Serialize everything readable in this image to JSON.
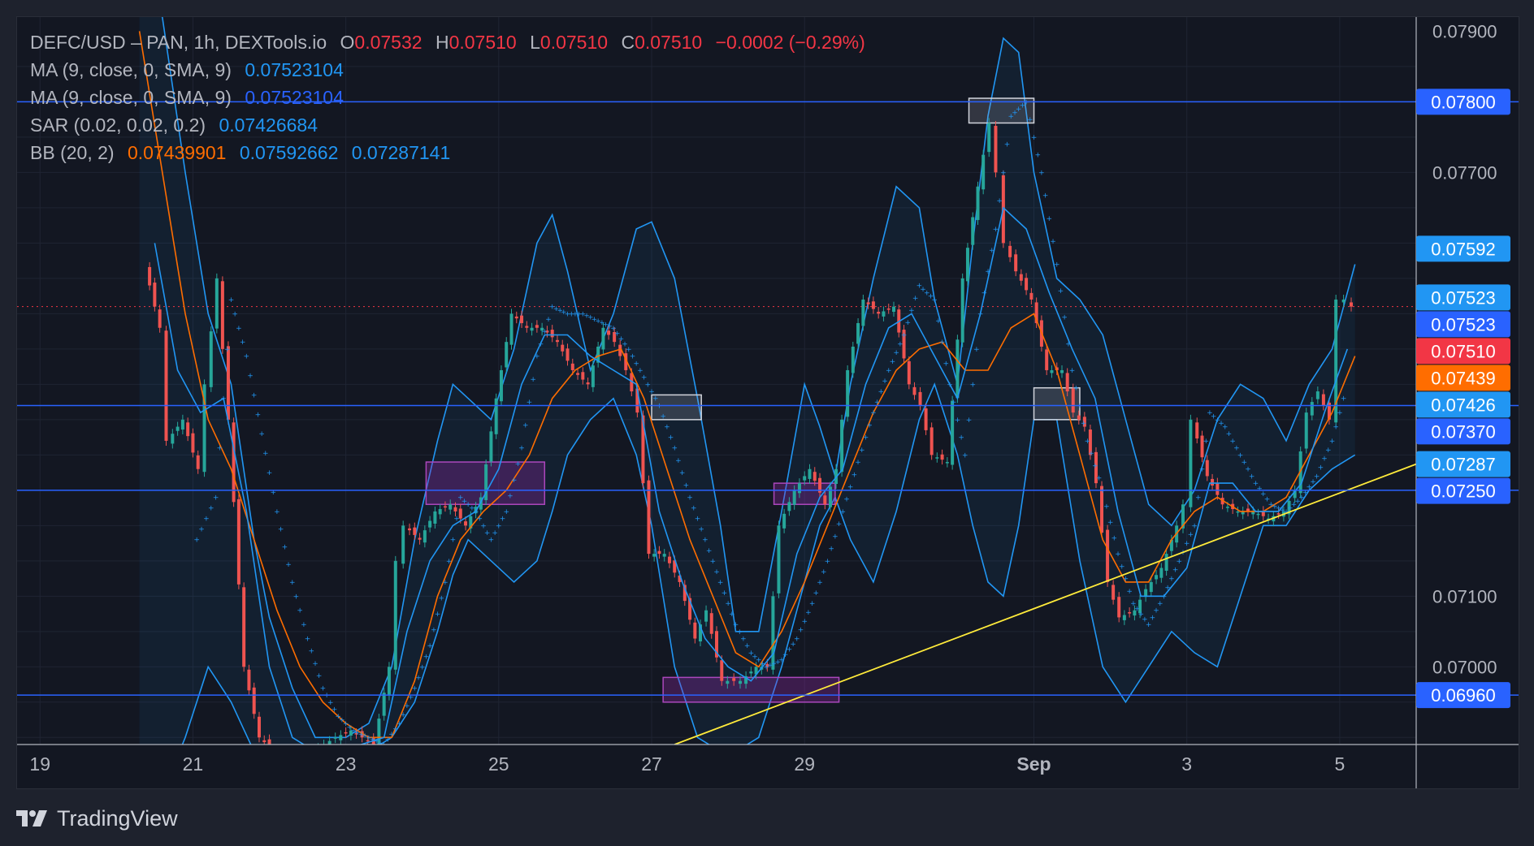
{
  "legend": {
    "title": "DEFC/USD – PAN, 1h, DEXTools.io",
    "o_label": "O",
    "o_value": "0.07532",
    "h_label": "H",
    "h_value": "0.07510",
    "l_label": "L",
    "l_value": "0.07510",
    "c_label": "C",
    "c_value": "0.07510",
    "change": "−0.0002 (−0.29%)",
    "ma1_label": "MA (9, close, 0, SMA, 9)",
    "ma1_value": "0.07523104",
    "ma2_label": "MA (9, close, 0, SMA, 9)",
    "ma2_value": "0.07523104",
    "sar_label": "SAR (0.02, 0.02, 0.2)",
    "sar_value": "0.07426684",
    "bb_label": "BB (20, 2)",
    "bb_mid": "0.07439901",
    "bb_upper": "0.07592662",
    "bb_lower": "0.07287141"
  },
  "footer": {
    "brand": "TradingView",
    "logo_icon": "tradingview-logo-icon"
  },
  "colors": {
    "background": "#131722",
    "grid": "#1f2433",
    "text": "#b2b5be",
    "up": "#26a69a",
    "down": "#ef5350",
    "bb_band": "#2962ff",
    "bb_basis": "#ff6d00",
    "ma": "#2196f3",
    "sar": "#2196f3",
    "hline": "#2962ff",
    "trendline": "#ffeb3b",
    "label_blue": "#2962ff",
    "label_lightblue": "#2196f3",
    "label_red": "#f23645",
    "label_orange": "#ff6d00"
  },
  "chart_data": {
    "type": "candlestick",
    "symbol": "DEFC/USD",
    "interval": "1h",
    "x_tick_labels": [
      "19",
      "21",
      "23",
      "25",
      "27",
      "29",
      "Sep",
      "3",
      "5"
    ],
    "x_tick_days": [
      19,
      21,
      23,
      25,
      27,
      29,
      32,
      34,
      36
    ],
    "y_tick_labels": [
      "0.07900",
      "0.07700",
      "0.07100",
      "0.07000"
    ],
    "y_tick_values": [
      0.079,
      0.077,
      0.071,
      0.07
    ],
    "ylim": [
      0.0689,
      0.0792
    ],
    "xlim_days": [
      18.7,
      37.0
    ],
    "price_labels": [
      {
        "text": "0.07800",
        "value": 0.078,
        "color": "#2962ff"
      },
      {
        "text": "0.07592",
        "value": 0.07592,
        "color": "#2196f3"
      },
      {
        "text": "0.07523",
        "value": 0.07523,
        "color": "#2196f3"
      },
      {
        "text": "0.07523",
        "value": 0.07523,
        "color": "#2962ff"
      },
      {
        "text": "0.07510",
        "value": 0.0751,
        "color": "#f23645"
      },
      {
        "text": "0.07439",
        "value": 0.07439,
        "color": "#ff6d00"
      },
      {
        "text": "0.07426",
        "value": 0.07426,
        "color": "#2196f3"
      },
      {
        "text": "0.07370",
        "value": 0.0737,
        "color": "#2962ff"
      },
      {
        "text": "0.07287",
        "value": 0.07287,
        "color": "#2196f3"
      },
      {
        "text": "0.07250",
        "value": 0.0725,
        "color": "#2962ff"
      },
      {
        "text": "0.06960",
        "value": 0.0696,
        "color": "#2962ff"
      }
    ],
    "horizontal_lines": [
      0.078,
      0.0737,
      0.0725,
      0.0696
    ],
    "last_price": 0.0751,
    "trendline": {
      "x": [
        27.3,
        37.0
      ],
      "y": [
        0.0689,
        0.07287
      ]
    },
    "zones": [
      {
        "type": "supply-demand",
        "color": "purple",
        "x": [
          24.05,
          25.6
        ],
        "y": [
          0.0723,
          0.0729
        ]
      },
      {
        "type": "supply-demand",
        "color": "purple",
        "x": [
          27.15,
          29.45
        ],
        "y": [
          0.0695,
          0.06985
        ]
      },
      {
        "type": "supply-demand",
        "color": "purple",
        "x": [
          28.6,
          29.4
        ],
        "y": [
          0.0723,
          0.0726
        ]
      },
      {
        "type": "highlight",
        "color": "gray",
        "x": [
          27.0,
          27.65
        ],
        "y": [
          0.0735,
          0.07385
        ]
      },
      {
        "type": "highlight",
        "color": "gray",
        "x": [
          31.15,
          32.0
        ],
        "y": [
          0.0777,
          0.07805
        ]
      },
      {
        "type": "highlight",
        "color": "gray",
        "x": [
          32.0,
          32.6
        ],
        "y": [
          0.0735,
          0.07395
        ]
      }
    ],
    "close_path": {
      "x": [
        20.4,
        20.6,
        20.7,
        20.9,
        21.1,
        21.2,
        21.35,
        21.5,
        21.7,
        21.9,
        22.1,
        22.3,
        22.6,
        22.9,
        23.1,
        23.4,
        23.6,
        23.7,
        23.8,
        24.0,
        24.2,
        24.4,
        24.6,
        24.8,
        25.0,
        25.2,
        25.4,
        25.6,
        25.8,
        26.0,
        26.2,
        26.4,
        26.55,
        26.7,
        26.85,
        27.0,
        27.2,
        27.4,
        27.6,
        27.75,
        27.95,
        28.2,
        28.4,
        28.55,
        28.7,
        28.9,
        29.1,
        29.3,
        29.45,
        29.6,
        29.8,
        30.0,
        30.2,
        30.4,
        30.55,
        30.7,
        30.9,
        31.1,
        31.3,
        31.45,
        31.55,
        31.65,
        31.8,
        32.0,
        32.2,
        32.4,
        32.55,
        32.7,
        32.85,
        33.0,
        33.15,
        33.35,
        33.5,
        33.7,
        33.9,
        34.0,
        34.1,
        34.3,
        34.5,
        34.7,
        34.9,
        35.1,
        35.3,
        35.45,
        35.6,
        35.75,
        35.9,
        36.0,
        36.1,
        36.2
      ],
      "y": [
        0.0757,
        0.0748,
        0.0732,
        0.0735,
        0.0728,
        0.074,
        0.0755,
        0.0735,
        0.07,
        0.069,
        0.0688,
        0.0687,
        0.0688,
        0.069,
        0.0691,
        0.0689,
        0.07,
        0.0715,
        0.072,
        0.0718,
        0.0722,
        0.0723,
        0.072,
        0.0724,
        0.0738,
        0.075,
        0.0748,
        0.0748,
        0.0746,
        0.0742,
        0.074,
        0.0748,
        0.0746,
        0.0742,
        0.0736,
        0.0716,
        0.0716,
        0.0712,
        0.0704,
        0.0708,
        0.0698,
        0.0698,
        0.07,
        0.07,
        0.072,
        0.0725,
        0.0728,
        0.0723,
        0.0728,
        0.0742,
        0.0752,
        0.075,
        0.0751,
        0.074,
        0.0737,
        0.073,
        0.0729,
        0.0755,
        0.0768,
        0.0777,
        0.077,
        0.076,
        0.0756,
        0.0752,
        0.0742,
        0.0742,
        0.0736,
        0.0734,
        0.0726,
        0.0712,
        0.0707,
        0.0708,
        0.0711,
        0.0714,
        0.072,
        0.0723,
        0.0735,
        0.0727,
        0.0723,
        0.0722,
        0.0722,
        0.0721,
        0.0722,
        0.0725,
        0.0736,
        0.0739,
        0.0735,
        0.0752,
        0.0752,
        0.0751
      ]
    },
    "bb_upper_path": {
      "x": [
        20.3,
        20.6,
        20.9,
        21.2,
        21.5,
        21.8,
        22.0,
        22.3,
        22.6,
        23.0,
        23.3,
        23.6,
        23.9,
        24.2,
        24.4,
        24.6,
        24.9,
        25.2,
        25.5,
        25.7,
        25.9,
        26.2,
        26.5,
        26.8,
        27.0,
        27.3,
        27.6,
        27.9,
        28.1,
        28.4,
        28.7,
        29.0,
        29.2,
        29.4,
        29.6,
        29.9,
        30.2,
        30.5,
        30.7,
        31.0,
        31.2,
        31.4,
        31.6,
        31.8,
        32.0,
        32.3,
        32.6,
        32.9,
        33.2,
        33.5,
        33.8,
        34.1,
        34.4,
        34.7,
        35.0,
        35.3,
        35.6,
        35.9,
        36.2
      ],
      "y": [
        0.0795,
        0.0792,
        0.077,
        0.075,
        0.074,
        0.0718,
        0.0707,
        0.0697,
        0.069,
        0.069,
        0.0692,
        0.07,
        0.0718,
        0.0732,
        0.074,
        0.0738,
        0.0735,
        0.0745,
        0.076,
        0.0764,
        0.0756,
        0.0742,
        0.075,
        0.0762,
        0.0763,
        0.0755,
        0.0738,
        0.072,
        0.0705,
        0.0705,
        0.0722,
        0.074,
        0.0734,
        0.0727,
        0.074,
        0.0755,
        0.0768,
        0.0765,
        0.0752,
        0.074,
        0.076,
        0.0778,
        0.0789,
        0.0787,
        0.077,
        0.0755,
        0.0752,
        0.0747,
        0.0735,
        0.0723,
        0.072,
        0.0725,
        0.0735,
        0.074,
        0.0738,
        0.0732,
        0.074,
        0.0745,
        0.0757
      ]
    },
    "bb_lower_path": {
      "x": [
        20.3,
        20.6,
        20.9,
        21.2,
        21.5,
        21.8,
        22.0,
        22.3,
        22.6,
        23.0,
        23.3,
        23.6,
        23.9,
        24.2,
        24.4,
        24.6,
        24.9,
        25.2,
        25.5,
        25.7,
        25.9,
        26.2,
        26.5,
        26.8,
        27.0,
        27.3,
        27.6,
        27.9,
        28.1,
        28.4,
        28.7,
        29.0,
        29.2,
        29.4,
        29.6,
        29.9,
        30.2,
        30.5,
        30.7,
        31.0,
        31.2,
        31.4,
        31.6,
        31.8,
        32.0,
        32.3,
        32.6,
        32.9,
        33.2,
        33.5,
        33.8,
        34.1,
        34.4,
        34.7,
        35.0,
        35.3,
        35.6,
        35.9,
        36.2
      ],
      "y": [
        0.068,
        0.0682,
        0.069,
        0.07,
        0.0695,
        0.0688,
        0.0686,
        0.0686,
        0.0687,
        0.0688,
        0.0688,
        0.069,
        0.0695,
        0.0705,
        0.0713,
        0.0718,
        0.0715,
        0.0712,
        0.0715,
        0.0722,
        0.073,
        0.0735,
        0.0738,
        0.073,
        0.072,
        0.07,
        0.069,
        0.0688,
        0.0688,
        0.069,
        0.07,
        0.0712,
        0.072,
        0.0724,
        0.0718,
        0.0712,
        0.0722,
        0.0735,
        0.074,
        0.073,
        0.072,
        0.0712,
        0.071,
        0.072,
        0.0735,
        0.0735,
        0.0715,
        0.07,
        0.0695,
        0.07,
        0.0705,
        0.0702,
        0.07,
        0.071,
        0.072,
        0.072,
        0.0725,
        0.0728,
        0.073
      ]
    },
    "bb_basis_path": {
      "x": [
        20.3,
        20.6,
        20.9,
        21.2,
        21.5,
        21.8,
        22.1,
        22.4,
        22.7,
        23.0,
        23.3,
        23.6,
        23.9,
        24.2,
        24.5,
        24.8,
        25.1,
        25.4,
        25.7,
        26.0,
        26.3,
        26.6,
        26.9,
        27.2,
        27.5,
        27.8,
        28.1,
        28.4,
        28.7,
        29.0,
        29.3,
        29.6,
        29.9,
        30.2,
        30.5,
        30.8,
        31.1,
        31.4,
        31.7,
        32.0,
        32.3,
        32.6,
        32.9,
        33.2,
        33.5,
        33.8,
        34.1,
        34.4,
        34.7,
        35.0,
        35.3,
        35.6,
        35.9,
        36.2
      ],
      "y": [
        0.079,
        0.077,
        0.075,
        0.0735,
        0.0728,
        0.0718,
        0.0708,
        0.07,
        0.0695,
        0.0692,
        0.069,
        0.069,
        0.0698,
        0.071,
        0.0718,
        0.0722,
        0.0725,
        0.073,
        0.0738,
        0.0742,
        0.0744,
        0.0745,
        0.0738,
        0.0728,
        0.0718,
        0.071,
        0.0702,
        0.07,
        0.0705,
        0.0712,
        0.072,
        0.0728,
        0.0736,
        0.0742,
        0.0745,
        0.0746,
        0.0742,
        0.0742,
        0.0748,
        0.075,
        0.0742,
        0.073,
        0.0718,
        0.0712,
        0.0712,
        0.0718,
        0.0722,
        0.0724,
        0.0722,
        0.0722,
        0.0724,
        0.073,
        0.0736,
        0.0744
      ]
    },
    "ma_path": {
      "x": [
        20.5,
        20.8,
        21.1,
        21.4,
        21.7,
        22.0,
        22.3,
        22.6,
        22.9,
        23.2,
        23.5,
        23.8,
        24.1,
        24.4,
        24.7,
        25.0,
        25.3,
        25.6,
        25.9,
        26.2,
        26.5,
        26.8,
        27.1,
        27.4,
        27.7,
        28.0,
        28.3,
        28.6,
        28.9,
        29.2,
        29.5,
        29.8,
        30.1,
        30.4,
        30.7,
        31.0,
        31.3,
        31.6,
        31.9,
        32.2,
        32.5,
        32.8,
        33.1,
        33.4,
        33.7,
        34.0,
        34.3,
        34.6,
        34.9,
        35.2,
        35.5,
        35.8,
        36.1
      ],
      "y": [
        0.076,
        0.0742,
        0.0736,
        0.0738,
        0.0722,
        0.07,
        0.069,
        0.0688,
        0.0688,
        0.0689,
        0.069,
        0.0705,
        0.0715,
        0.072,
        0.0722,
        0.0728,
        0.074,
        0.0747,
        0.0747,
        0.0744,
        0.0742,
        0.074,
        0.0722,
        0.0712,
        0.0704,
        0.07,
        0.0698,
        0.0702,
        0.0716,
        0.0724,
        0.0728,
        0.074,
        0.0748,
        0.075,
        0.0744,
        0.0738,
        0.075,
        0.0765,
        0.0762,
        0.0753,
        0.0745,
        0.0738,
        0.0722,
        0.071,
        0.071,
        0.0714,
        0.0726,
        0.0726,
        0.0722,
        0.0722,
        0.0726,
        0.0736,
        0.0745
      ]
    },
    "sar_path": {
      "x": [
        21.05,
        21.3,
        21.5,
        21.7,
        21.9,
        22.1,
        22.3,
        22.5,
        22.7,
        22.9,
        23.1,
        23.3,
        23.5,
        23.7,
        23.9,
        24.1,
        24.3,
        24.5,
        24.7,
        24.9,
        25.1,
        25.3,
        25.5,
        25.7,
        25.9,
        26.1,
        26.3,
        26.5,
        26.7,
        26.9,
        27.1,
        27.3,
        27.5,
        27.7,
        27.9,
        28.1,
        28.3,
        28.5,
        28.7,
        28.9,
        29.1,
        29.3,
        29.5,
        29.7,
        29.9,
        30.1,
        30.3,
        30.5,
        30.7,
        30.9,
        31.1,
        31.3,
        31.5,
        31.7,
        31.9,
        32.1,
        32.3,
        32.5,
        32.7,
        32.9,
        33.1,
        33.3,
        33.5,
        33.7,
        33.9,
        34.1,
        34.3,
        34.5,
        34.7,
        34.9,
        35.1,
        35.3,
        35.5,
        35.7,
        35.9,
        36.1
      ],
      "y": [
        0.0718,
        0.0724,
        0.0752,
        0.0744,
        0.0733,
        0.0722,
        0.0712,
        0.0704,
        0.0697,
        0.0693,
        0.0691,
        0.069,
        0.0689,
        0.0692,
        0.0697,
        0.0703,
        0.0712,
        0.0724,
        0.0722,
        0.0718,
        0.0722,
        0.0731,
        0.0744,
        0.0751,
        0.075,
        0.075,
        0.0749,
        0.0748,
        0.0745,
        0.0741,
        0.0737,
        0.0731,
        0.0724,
        0.0718,
        0.0712,
        0.0706,
        0.0702,
        0.07,
        0.0701,
        0.0704,
        0.0709,
        0.0715,
        0.0722,
        0.0729,
        0.0736,
        0.0742,
        0.0747,
        0.0754,
        0.0752,
        0.074,
        0.073,
        0.075,
        0.0762,
        0.0778,
        0.078,
        0.077,
        0.0757,
        0.0742,
        0.0732,
        0.0725,
        0.0716,
        0.0709,
        0.0706,
        0.071,
        0.0715,
        0.072,
        0.0736,
        0.0734,
        0.073,
        0.0726,
        0.0723,
        0.0722,
        0.0724,
        0.0727,
        0.0732,
        0.074
      ]
    }
  }
}
